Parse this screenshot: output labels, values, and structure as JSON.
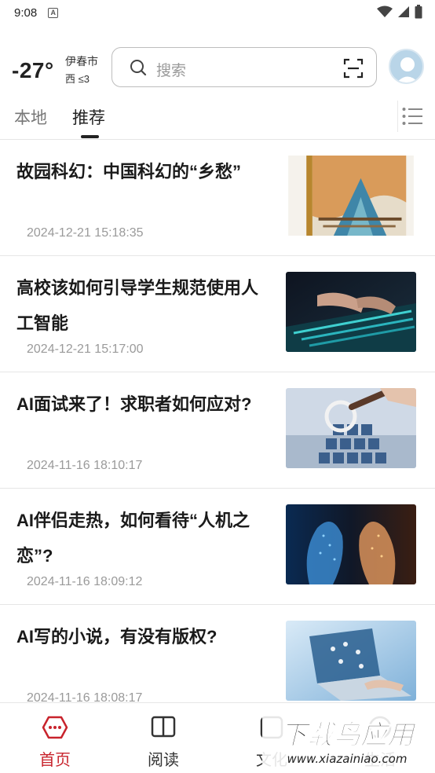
{
  "status_bar": {
    "time": "9:08",
    "notification_icon": "a-badge-icon"
  },
  "header": {
    "temperature": "-27°",
    "city": "伊春市",
    "wind": "西 ≤3",
    "search_placeholder": "搜索"
  },
  "tabs": [
    {
      "label": "本地",
      "active": false
    },
    {
      "label": "推荐",
      "active": true
    }
  ],
  "articles": [
    {
      "title": "故园科幻：中国科幻的“乡愁”",
      "date": "2024-12-21 15:18:35",
      "thumb": "book-cover"
    },
    {
      "title": "高校该如何引导学生规范使用人工智能",
      "date": "2024-12-21 15:17:00",
      "thumb": "keyboard-hands"
    },
    {
      "title": "AI面试来了！求职者如何应对?",
      "date": "2024-11-16 18:10:17",
      "thumb": "magnifier-people"
    },
    {
      "title": "AI伴侣走热，如何看待“人机之恋”?",
      "date": "2024-11-16 18:09:12",
      "thumb": "ai-faces"
    },
    {
      "title": "AI写的小说，有没有版权?",
      "date": "2024-11-16 18:08:17",
      "thumb": "laptop-icons"
    }
  ],
  "bottom_nav": [
    {
      "label": "首页",
      "icon": "home-icon",
      "active": true
    },
    {
      "label": "阅读",
      "icon": "book-icon",
      "active": false
    },
    {
      "label": "文化",
      "icon": "culture-icon",
      "active": false
    },
    {
      "label": "生活",
      "icon": "life-icon",
      "active": false
    }
  ],
  "watermark": {
    "main": "下载鸟应用",
    "sub": "www.xiazainiao.com"
  },
  "colors": {
    "accent": "#c8232c",
    "text": "#222222",
    "muted": "#9a9a9a"
  }
}
